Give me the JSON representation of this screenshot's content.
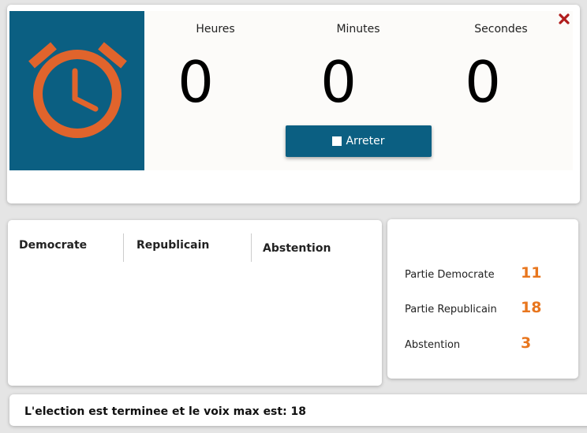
{
  "timer": {
    "labels": {
      "hours": "Heures",
      "minutes": "Minutes",
      "seconds": "Secondes"
    },
    "values": {
      "hours": "0",
      "minutes": "0",
      "seconds": "0"
    },
    "stop_label": "Arreter",
    "icons": {
      "alarm": "alarm-clock-icon",
      "stop": "stop-square-icon",
      "close": "close-x-icon"
    }
  },
  "votes_table": {
    "columns": [
      "Democrate",
      "Republicain",
      "Abstention"
    ]
  },
  "results": [
    {
      "label": "Partie Democrate",
      "value": "11"
    },
    {
      "label": "Partie Republicain",
      "value": "18"
    },
    {
      "label": "Abstention",
      "value": "3"
    }
  ],
  "status": {
    "message": "L'election est terminee et le voix max est: 18"
  },
  "colors": {
    "primary": "#0b5f82",
    "accent": "#e8761e",
    "alarm_icon": "#e0642c",
    "close": "#b01c1c",
    "background": "#e5e5e5"
  }
}
